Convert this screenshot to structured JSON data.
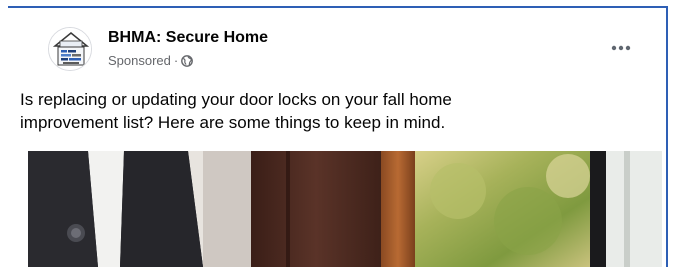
{
  "post": {
    "page_name": "BHMA: Secure Home",
    "sponsored_label": "Sponsored",
    "separator": "·",
    "more_icon": "more-options-icon",
    "audience_icon": "globe-icon",
    "text_line1": "Is replacing or updating your door locks on your fall home",
    "text_line2": "improvement list? Here are some things to keep in mind.",
    "logo_text": "BHMA",
    "accent_color": "#2e5fb5"
  }
}
